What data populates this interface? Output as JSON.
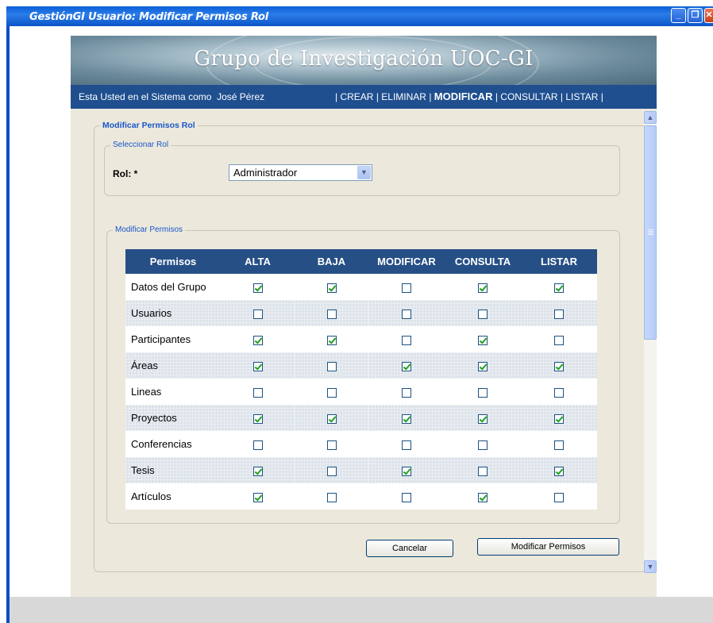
{
  "window": {
    "title": "GestiónGI Usuario: Modificar Permisos Rol",
    "minimize_icon": "_",
    "restore_icon": "❐",
    "close_icon": "✕"
  },
  "banner": {
    "title": "Grupo de Investigación UOC-GI"
  },
  "nav": {
    "user_prefix": "Esta Usted en el Sistema como",
    "user_name": "José Pérez",
    "sep": "|",
    "links": [
      "CREAR",
      "ELIMINAR",
      "MODIFICAR",
      "CONSULTAR",
      "LISTAR"
    ],
    "active": "MODIFICAR"
  },
  "form": {
    "legend": "Modificar Permisos Rol",
    "select_section_legend": "Seleccionar Rol",
    "rol_label": "Rol: *",
    "rol_value": "Administrador",
    "permisos_section_legend": "Modificar Permisos"
  },
  "table": {
    "headers": [
      "Permisos",
      "ALTA",
      "BAJA",
      "MODIFICAR",
      "CONSULTA",
      "LISTAR"
    ],
    "rows": [
      {
        "name": "Datos del Grupo",
        "checks": [
          true,
          true,
          false,
          true,
          true
        ]
      },
      {
        "name": "Usuarios",
        "checks": [
          false,
          false,
          false,
          false,
          false
        ]
      },
      {
        "name": "Participantes",
        "checks": [
          true,
          true,
          false,
          true,
          false
        ]
      },
      {
        "name": "Áreas",
        "checks": [
          true,
          false,
          true,
          true,
          true
        ]
      },
      {
        "name": "Lineas",
        "checks": [
          false,
          false,
          false,
          false,
          false
        ]
      },
      {
        "name": "Proyectos",
        "checks": [
          true,
          true,
          true,
          true,
          true
        ]
      },
      {
        "name": "Conferencias",
        "checks": [
          false,
          false,
          false,
          false,
          false
        ]
      },
      {
        "name": "Tesis",
        "checks": [
          true,
          false,
          true,
          false,
          true
        ]
      },
      {
        "name": "Artículos",
        "checks": [
          true,
          false,
          false,
          true,
          false
        ]
      }
    ]
  },
  "buttons": {
    "cancel": "Cancelar",
    "submit": "Modificar Permisos"
  },
  "scrollbar": {
    "up_icon": "▲",
    "down_icon": "▼"
  },
  "colors": {
    "title_bar": "#0a5fd6",
    "nav_bar": "#1f4f8f",
    "table_header": "#264f86",
    "panel_bg": "#ece9dc",
    "legend_text": "#1a55c9",
    "check": "#21a121"
  }
}
